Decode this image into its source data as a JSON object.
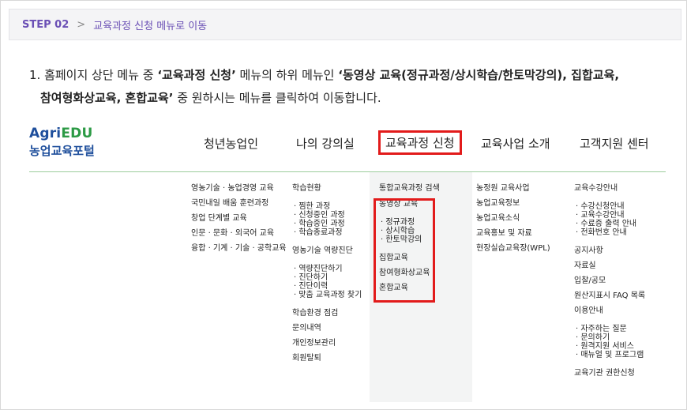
{
  "step": {
    "label": "STEP 02",
    "chevron": ">",
    "title": "교육과정 신청 메뉴로 이동"
  },
  "instruction": {
    "p1": "1. 홈페이지 상단 메뉴 중 ",
    "b1": "‘교육과정 신청’",
    "p2": " 메뉴의 하위 메뉴인 ",
    "b2": "‘동영상 교육(정규과정/상시학습/한토막강의), 집합교육,",
    "b3": "참여형화상교육, 혼합교육’",
    "p3": " 중 원하시는 메뉴를 클릭하여 이동합니다."
  },
  "logo": {
    "agri": "Agri",
    "edu": "EDU",
    "sub": "농업교육포털"
  },
  "gnb": [
    "청년농업인",
    "나의 강의실",
    "교육과정 신청",
    "교육사업 소개",
    "고객지원 센터"
  ],
  "col1": [
    "영농기술 · 농업경영 교육",
    "국민내일 배움 훈련과정",
    "창업 단계별 교육",
    "인문 · 문화 · 외국어 교육",
    "융합 · 기계 · 기술 · 공학교육"
  ],
  "col2": {
    "h1": "학습현황",
    "s1": [
      "· 찜한 과정",
      "· 신청중인 과정",
      "· 학습중인 과정",
      "· 학습종료과정"
    ],
    "h2": "영농기술 역량진단",
    "s2": [
      "· 역량진단하기",
      "· 진단하기",
      "· 진단이력",
      "· 맞춤 교육과정 찾기"
    ],
    "h3": [
      "학습환경 점검",
      "문의내역",
      "개인정보관리",
      "회원탈퇴"
    ]
  },
  "col3": {
    "h0": "통합교육과정 검색",
    "h1": "동영상 교육",
    "s1": [
      "· 정규과정",
      "· 상시학습",
      "· 한토막강의"
    ],
    "h2": [
      "집합교육",
      "참여형화상교육",
      "혼합교육"
    ]
  },
  "col4": [
    "농정원 교육사업",
    "농업교육정보",
    "농업교육소식",
    "교육홍보 및 자료",
    "현장실습교육장(WPL)"
  ],
  "col5": {
    "h1": "교육수강안내",
    "s1": [
      "· 수강신청안내",
      "· 교육수강안내",
      "· 수료증 출력 안내",
      "· 전화번호 안내"
    ],
    "h2": [
      "공지사항",
      "자료실",
      "입찰/공모",
      "원산지표시 FAQ 목록",
      "이용안내"
    ],
    "s2": [
      "· 자주하는 질문",
      "· 문의하기",
      "· 원격지원 서비스",
      "· 매뉴얼 및 프로그램"
    ],
    "h3": "교육기관 권한신청"
  },
  "colors": {
    "accent": "#6a4fb5",
    "highlight": "#e21b1b",
    "brand_blue": "#1f4f9c",
    "brand_green": "#2c9a45"
  }
}
